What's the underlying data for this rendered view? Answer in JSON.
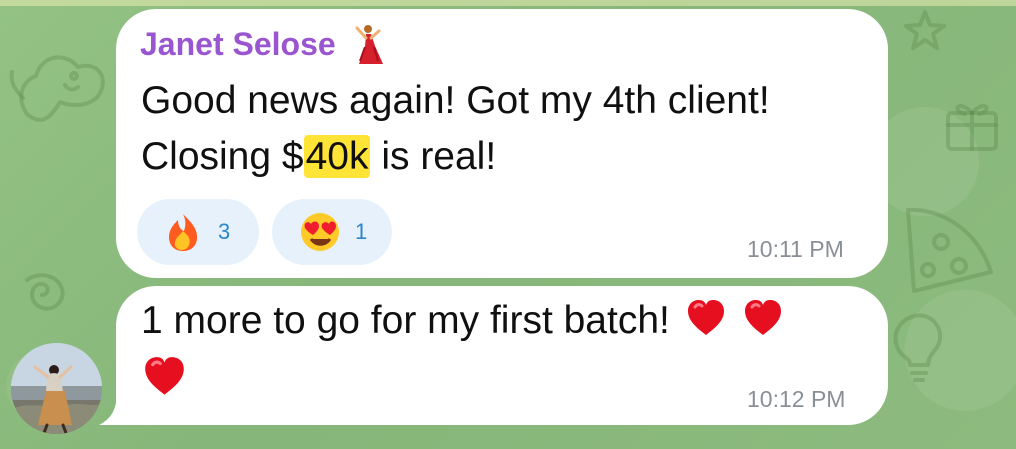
{
  "colors": {
    "chat_background": "#8dbb7f",
    "bubble": "#ffffff",
    "sender_name": "#9a55d0",
    "reaction_background": "#e7f1fb",
    "reaction_count": "#2b86cc",
    "timestamp": "#8a8f96",
    "highlight": "#ffe438"
  },
  "messages": [
    {
      "sender": "Janet Selose",
      "sender_icon": "dancer-emoji-icon",
      "text_line_1": "Good news again! Got my 4th client!",
      "text_line_2_before_highlight": "Closing $",
      "highlighted_text": "40k",
      "text_line_2_after_highlight": " is real!",
      "reactions": [
        {
          "icon": "fire-emoji-icon",
          "count": "3"
        },
        {
          "icon": "heart-eyes-emoji-icon",
          "count": "1"
        }
      ],
      "time": "10:11 PM"
    },
    {
      "text": "1 more to go for my first batch!",
      "emoji_icons": [
        "red-heart-icon",
        "red-heart-icon",
        "red-heart-icon"
      ],
      "time": "10:12 PM"
    }
  ],
  "avatar": {
    "icon": "sender-avatar"
  }
}
